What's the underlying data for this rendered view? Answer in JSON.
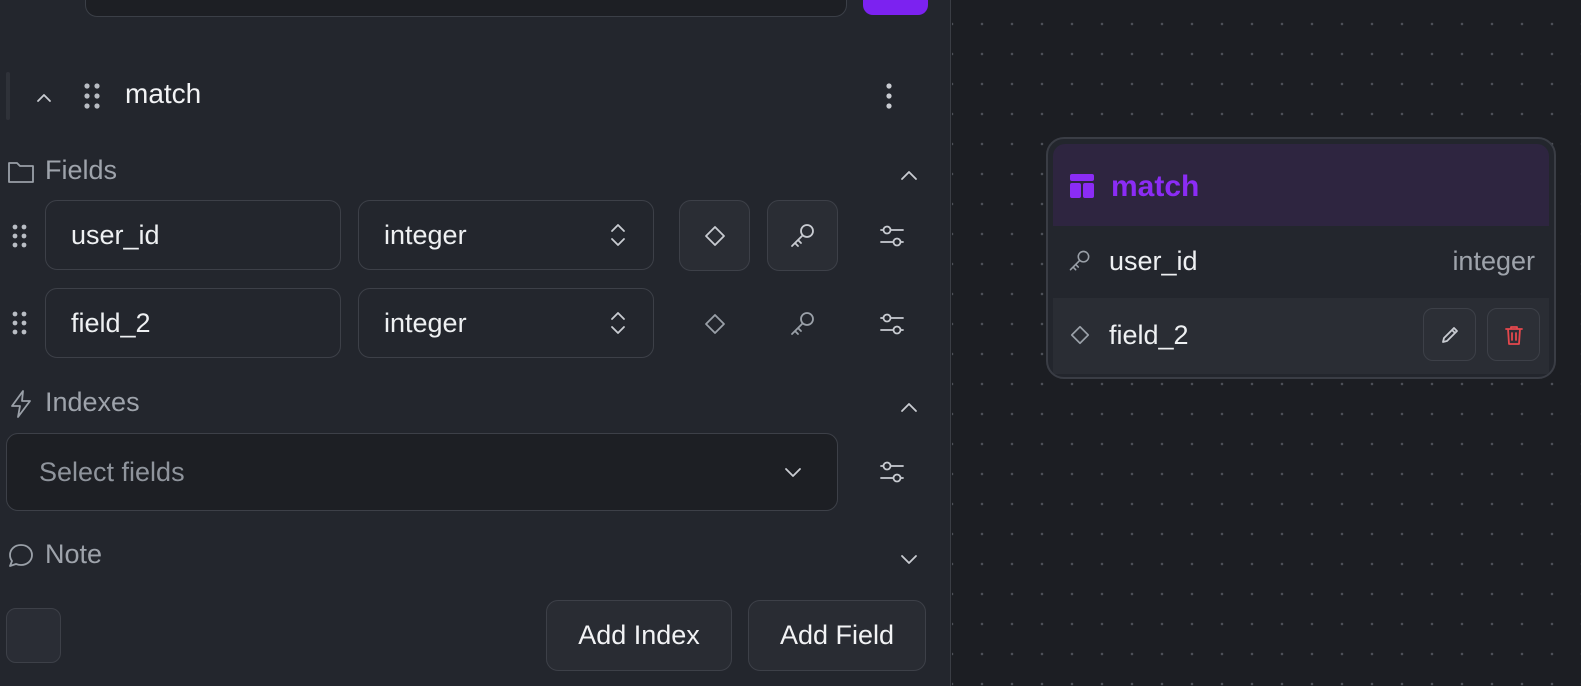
{
  "table": {
    "name": "match",
    "fields_label": "Fields",
    "indexes_label": "Indexes",
    "note_label": "Note",
    "fields": [
      {
        "name": "user_id",
        "type": "integer",
        "primary_key": true
      },
      {
        "name": "field_2",
        "type": "integer",
        "primary_key": false
      }
    ],
    "index_placeholder": "Select fields",
    "add_index_label": "Add Index",
    "add_field_label": "Add Field"
  },
  "node": {
    "title": "match",
    "fields": [
      {
        "name": "user_id",
        "type": "integer",
        "icon": "key-icon"
      },
      {
        "name": "field_2",
        "type": "",
        "icon": "diamond-icon"
      }
    ]
  },
  "colors": {
    "accent": "#7c22f0",
    "node_title": "#8b2cf5",
    "delete": "#e5484d"
  }
}
